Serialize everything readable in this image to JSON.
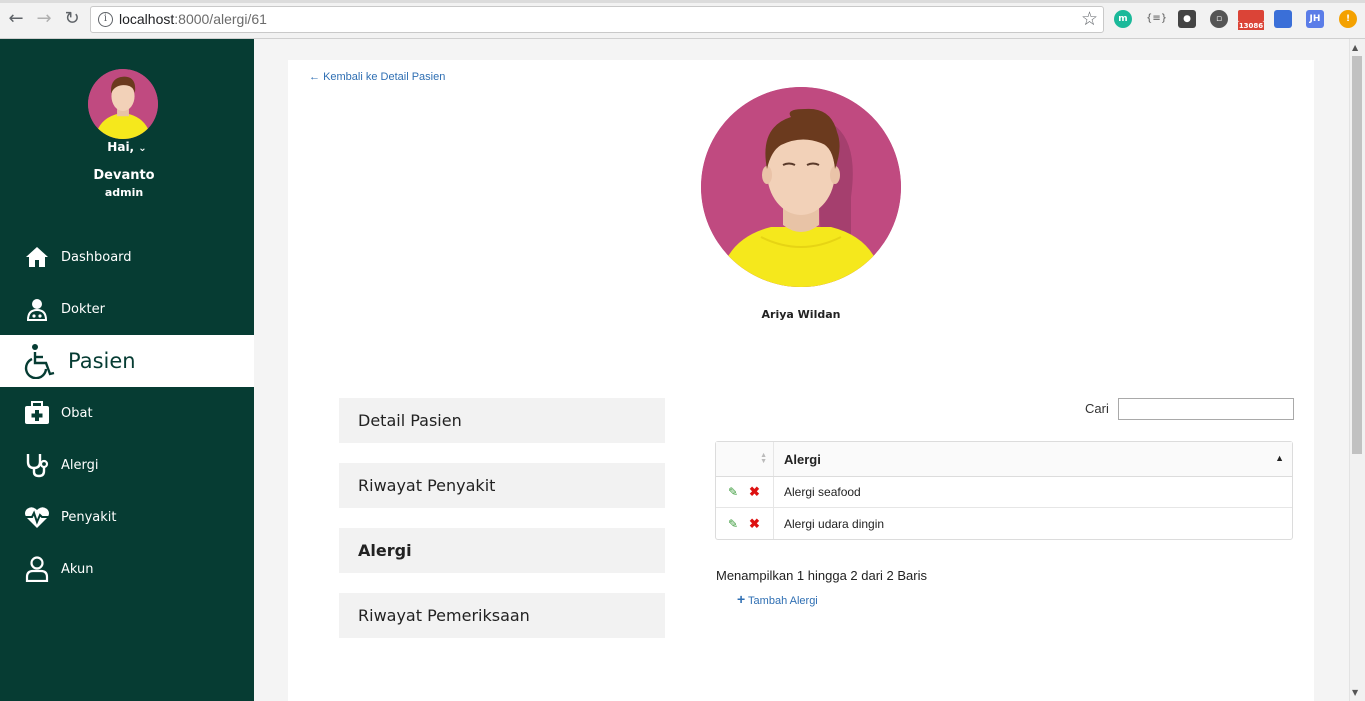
{
  "browser": {
    "url_host": "localhost",
    "url_rest": ":8000/alergi/61",
    "extension_badge": "13086",
    "extension_jh": "JH",
    "extension_m": "m",
    "extension_braces": "{≡}"
  },
  "sidebar": {
    "greeting": "Hai,",
    "username": "Devanto",
    "role": "admin",
    "items": [
      {
        "label": "Dashboard",
        "icon": "home-icon"
      },
      {
        "label": "Dokter",
        "icon": "doctor-icon"
      },
      {
        "label": "Pasien",
        "icon": "wheelchair-icon"
      },
      {
        "label": "Obat",
        "icon": "medkit-icon"
      },
      {
        "label": "Alergi",
        "icon": "stethoscope-icon"
      },
      {
        "label": "Penyakit",
        "icon": "heartbeat-icon"
      },
      {
        "label": "Akun",
        "icon": "user-icon"
      }
    ],
    "active_item": "Pasien",
    "colors": {
      "background": "#063c33",
      "active_background": "#ffffff"
    }
  },
  "main": {
    "back_link": "Kembali ke Detail Pasien",
    "patient_name": "Ariya Wildan",
    "tabs": [
      {
        "label": "Detail Pasien"
      },
      {
        "label": "Riwayat Penyakit"
      },
      {
        "label": "Alergi"
      },
      {
        "label": "Riwayat Pemeriksaan"
      }
    ],
    "active_tab": "Alergi",
    "search_label": "Cari",
    "search_value": "",
    "table": {
      "header": "Alergi",
      "rows": [
        {
          "alergi": "Alergi seafood"
        },
        {
          "alergi": "Alergi udara dingin"
        }
      ]
    },
    "info_text": "Menampilkan 1 hingga 2 dari 2 Baris",
    "add_link": "Tambah Alergi",
    "colors": {
      "avatar_bg": "#c04a80",
      "shirt": "#f5e81c",
      "link": "#2f6fb3"
    }
  }
}
